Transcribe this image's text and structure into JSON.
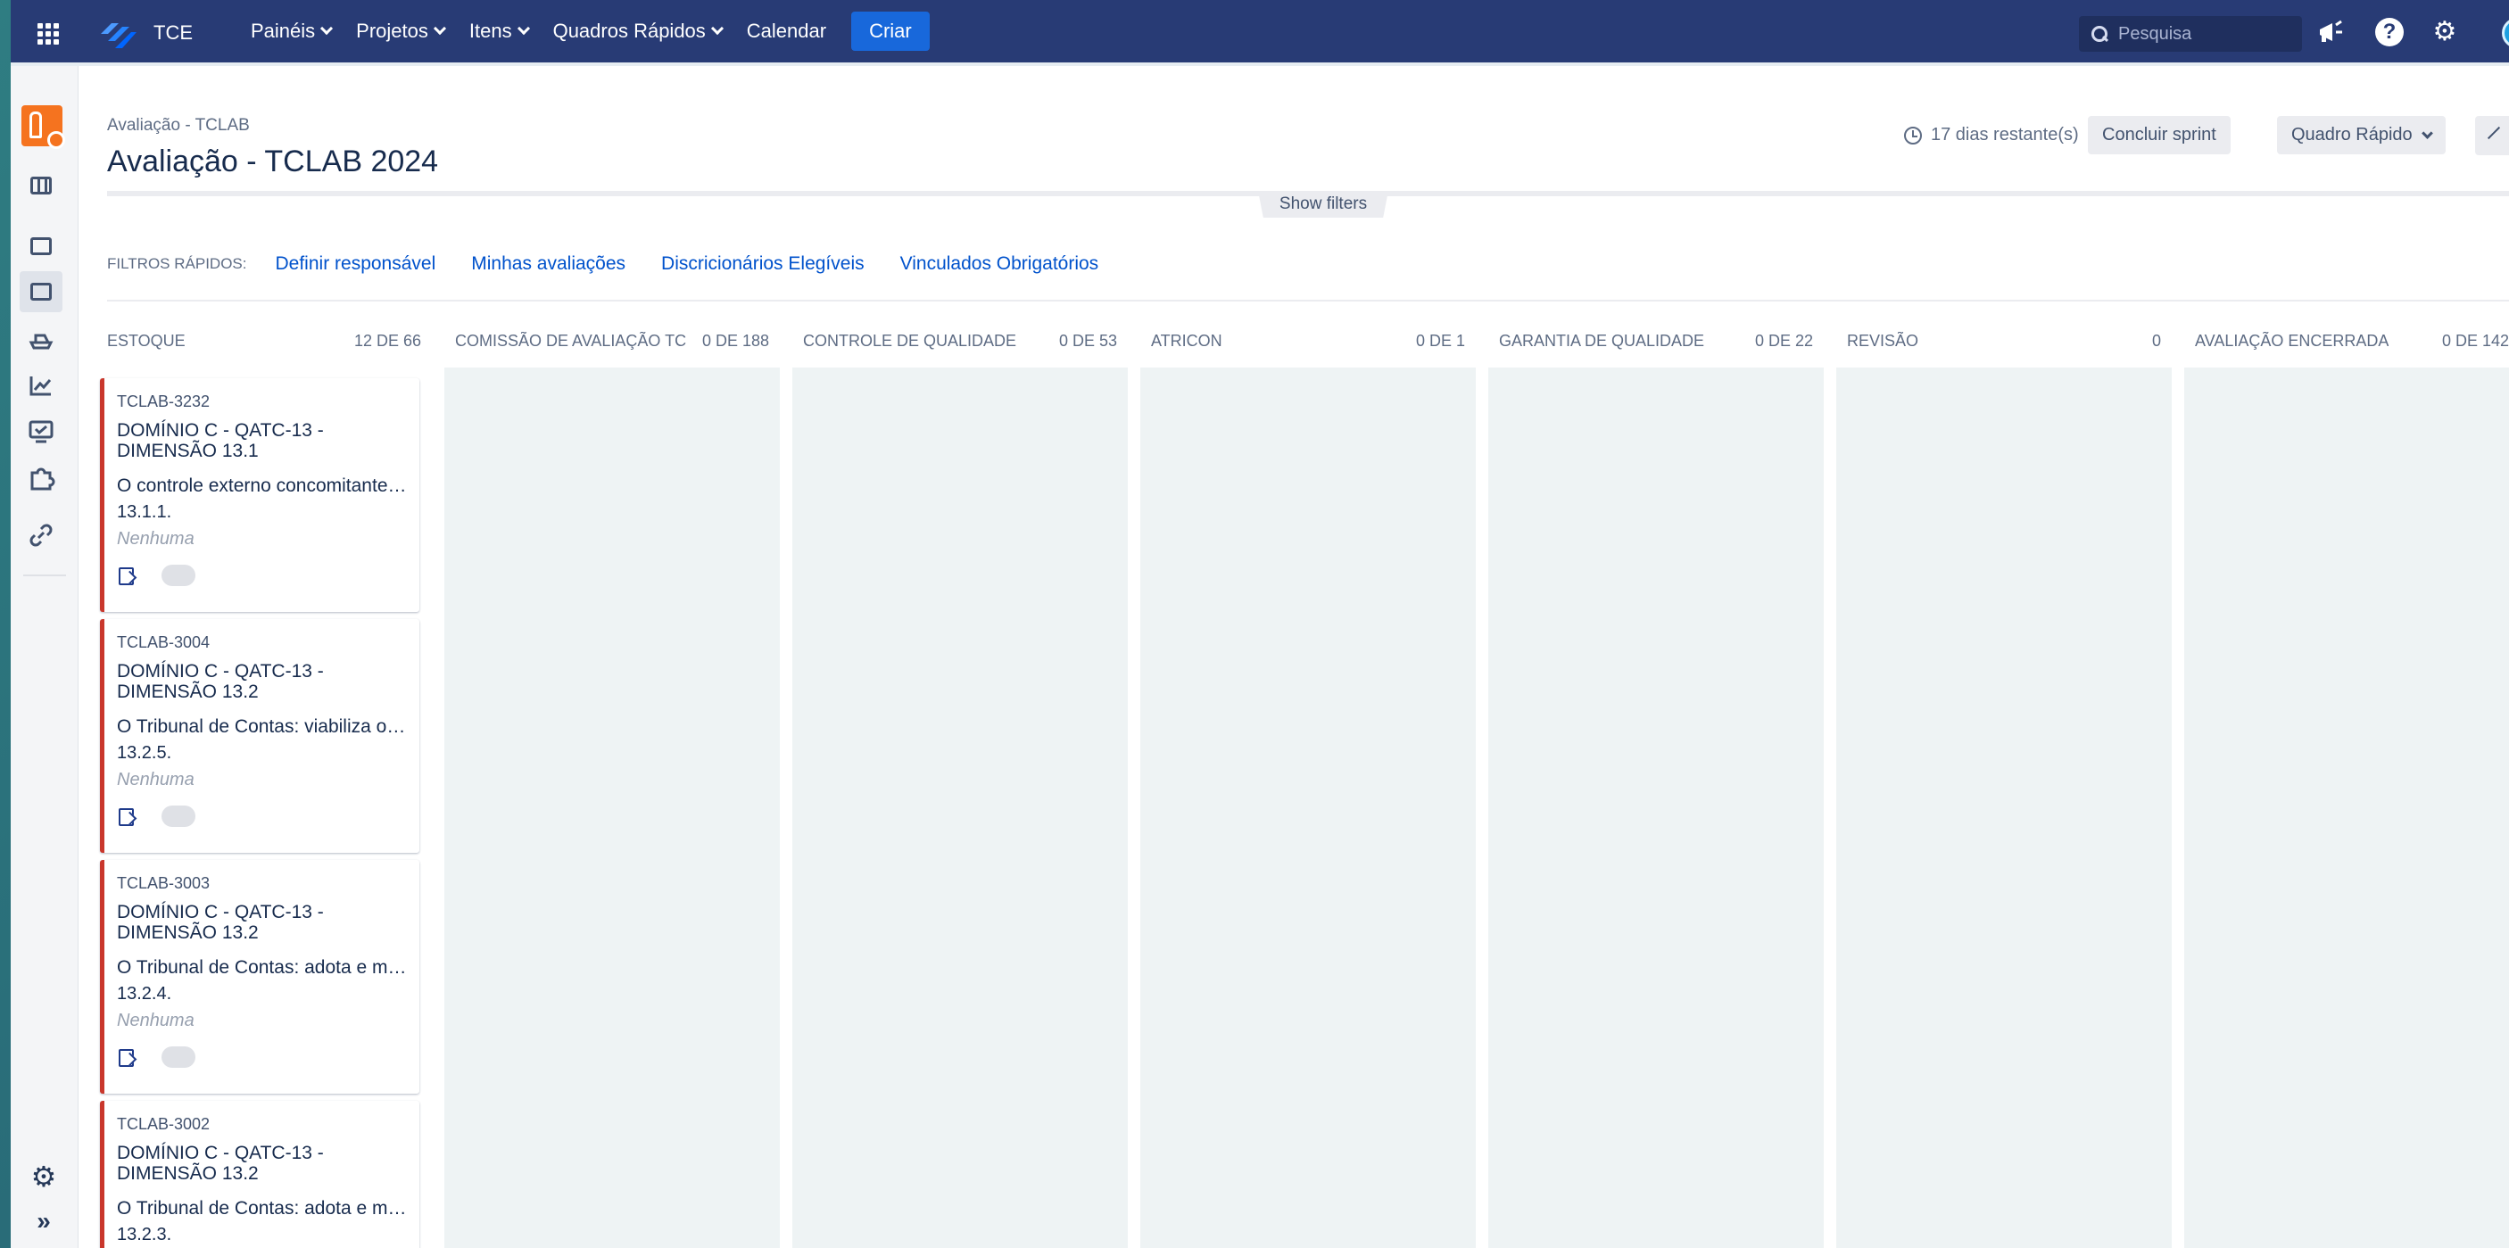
{
  "nav": {
    "brand": "TCE",
    "menu": [
      {
        "label": "Painéis",
        "dropdown": true
      },
      {
        "label": "Projetos",
        "dropdown": true
      },
      {
        "label": "Itens",
        "dropdown": true
      },
      {
        "label": "Quadros Rápidos",
        "dropdown": true
      },
      {
        "label": "Calendar",
        "dropdown": false
      }
    ],
    "create_label": "Criar",
    "search_placeholder": "Pesquisa",
    "accent": "#1868db",
    "bar_color": "#283b75"
  },
  "header": {
    "breadcrumb": "Avaliação - TCLAB",
    "title": "Avaliação - TCLAB 2024",
    "days_remaining": "17 dias restante(s)",
    "complete_sprint": "Concluir sprint",
    "board_select": "Quadro Rápido",
    "show_filters": "Show filters"
  },
  "quick_filters": {
    "label": "FILTROS RÁPIDOS:",
    "items": [
      "Definir responsável",
      "Minhas avaliações",
      "Discricionários Elegíveis",
      "Vinculados Obrigatórios"
    ]
  },
  "columns": [
    {
      "name": "ESTOQUE",
      "count": "12 DE 66"
    },
    {
      "name": "COMISSÃO DE AVALIAÇÃO TC",
      "count": "0 DE 188"
    },
    {
      "name": "CONTROLE DE QUALIDADE",
      "count": "0 DE 53"
    },
    {
      "name": "ATRICON",
      "count": "0 DE 1"
    },
    {
      "name": "GARANTIA DE QUALIDADE",
      "count": "0 DE 22"
    },
    {
      "name": "REVISÃO",
      "count": "0"
    },
    {
      "name": "AVALIAÇÃO ENCERRADA",
      "count": "0 DE 142"
    }
  ],
  "cards": [
    {
      "key": "TCLAB-3232",
      "title": "DOMÍNIO C - QATC-13 - DIMENSÃO 13.1",
      "summary": "O controle externo concomitante ...",
      "ref": "13.1.1.",
      "assignee": "Nenhuma"
    },
    {
      "key": "TCLAB-3004",
      "title": "DOMÍNIO C - QATC-13 - DIMENSÃO 13.2",
      "summary": "O Tribunal de Contas: viabiliza o r...",
      "ref": "13.2.5.",
      "assignee": "Nenhuma"
    },
    {
      "key": "TCLAB-3003",
      "title": "DOMÍNIO C - QATC-13 - DIMENSÃO 13.2",
      "summary": "O Tribunal de Contas: adota e mo...",
      "ref": "13.2.4.",
      "assignee": "Nenhuma"
    },
    {
      "key": "TCLAB-3002",
      "title": "DOMÍNIO C - QATC-13 - DIMENSÃO 13.2",
      "summary": "O Tribunal de Contas: adota e mo...",
      "ref": "13.2.3.",
      "assignee": ""
    }
  ],
  "colors": {
    "card_border": "#c9372c",
    "column_bg": "#eef3f4",
    "link": "#0052cc"
  },
  "icons": {
    "apps": "grid-icon",
    "notifications": "megaphone-icon",
    "help": "help-icon",
    "settings": "gear-icon",
    "sidebar": [
      "project-avatar",
      "backlog-icon",
      "board-icon",
      "releases-icon",
      "reports-icon",
      "issues-icon",
      "components-icon",
      "link-icon",
      "settings-icon",
      "expand-icon"
    ]
  }
}
